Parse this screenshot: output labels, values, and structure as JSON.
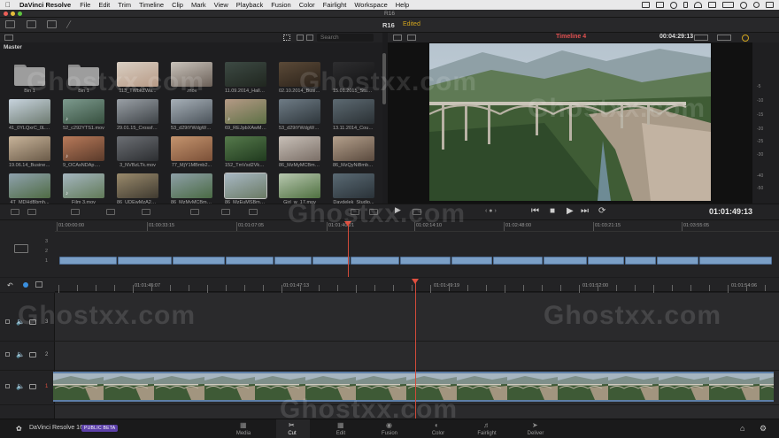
{
  "menubar": {
    "app": "DaVinci Resolve",
    "items": [
      "File",
      "Edit",
      "Trim",
      "Timeline",
      "Clip",
      "Mark",
      "View",
      "Playback",
      "Fusion",
      "Color",
      "Fairlight",
      "Workspace",
      "Help"
    ]
  },
  "window": {
    "title": "R16"
  },
  "project": {
    "name": "R16",
    "status": "Edited"
  },
  "pool": {
    "search_placeholder": "Search",
    "bin_label": "Master",
    "clips": [
      {
        "name": "Bin 1",
        "kind": "folder"
      },
      {
        "name": "Bin 1",
        "kind": "folder"
      },
      {
        "name": "113_TWbkZWa...",
        "kind": "video"
      },
      {
        "name": ".mov",
        "kind": "video"
      },
      {
        "name": "11.09.2014_Hallo...",
        "kind": "video"
      },
      {
        "name": "02.10.2014_Busin...",
        "kind": "video"
      },
      {
        "name": "15.01.2015_Studio...",
        "kind": "video"
      },
      {
        "name": "41_0YLQxrC_0L78...",
        "kind": "video"
      },
      {
        "name": "52_c292YTS1.mov",
        "kind": "video"
      },
      {
        "name": "29.01.15_Crossfit...",
        "kind": "video"
      },
      {
        "name": "53_d29tYWdgWS...",
        "kind": "video"
      },
      {
        "name": "69_REJpbXAwMjM...",
        "kind": "video"
      },
      {
        "name": "53_d29tYWdgWS...",
        "kind": "video"
      },
      {
        "name": "13.11.2014_Coupl...",
        "kind": "video"
      },
      {
        "name": "19.06.14_Business...",
        "kind": "video"
      },
      {
        "name": "9_OCAsNDAp.mov",
        "kind": "video"
      },
      {
        "name": "3_NVBzLTk.mov",
        "kind": "video"
      },
      {
        "name": "77_MjY1MBmb2...",
        "kind": "video"
      },
      {
        "name": "152_TmVsd2VkR...",
        "kind": "video"
      },
      {
        "name": "86_MzMyMCBmb...",
        "kind": "video"
      },
      {
        "name": "86_MzQyNiBmb29...",
        "kind": "video"
      },
      {
        "name": "4T_MDHdBbmh...",
        "kind": "video"
      },
      {
        "name": "Film 3.mov",
        "kind": "video"
      },
      {
        "name": "86_UDEwMzA2NT...",
        "kind": "video"
      },
      {
        "name": "86_MzMyMCBmb2...",
        "kind": "video"
      },
      {
        "name": "86_MzEuMSBmb2...",
        "kind": "video"
      },
      {
        "name": "Girl_w_17.mov",
        "kind": "video"
      },
      {
        "name": "Daydelek_Studio...",
        "kind": "video"
      }
    ]
  },
  "viewer": {
    "timeline_name": "Timeline 4",
    "timecode_top": "00:04:29:13",
    "timecode": "01:01:49:13",
    "meter_ticks": [
      "-5",
      "-10",
      "-15",
      "-20",
      "-25",
      "-30",
      "-40",
      "-50"
    ]
  },
  "upper_timeline": {
    "ruler": [
      "01:00:00:00",
      "01:00:33:15",
      "01:01:07:05",
      "01:01:40:21",
      "01:02:14:10",
      "01:02:48:00",
      "01:03:21:15",
      "01:03:55:05"
    ],
    "tracks": [
      "3",
      "2",
      "1"
    ]
  },
  "lower_timeline": {
    "ruler": [
      "01:01:45:07",
      "01:01:47:13",
      "01:01:49:19",
      "01:01:52:00",
      "01:01:54:06"
    ],
    "tracks": [
      "3",
      "2",
      "1"
    ]
  },
  "footer": {
    "brand": "DaVinci Resolve 16",
    "badge": "PUBLIC BETA",
    "pages": [
      "Media",
      "Cut",
      "Edit",
      "Fusion",
      "Color",
      "Fairlight",
      "Deliver"
    ],
    "active_page": "Cut"
  },
  "watermark": "Ghostxx.com",
  "colors": {
    "accent_red": "#e05040",
    "clip_blue": "#7b9fc6",
    "beta_purple": "#5b3fa8",
    "edited_gold": "#d2a51e"
  }
}
